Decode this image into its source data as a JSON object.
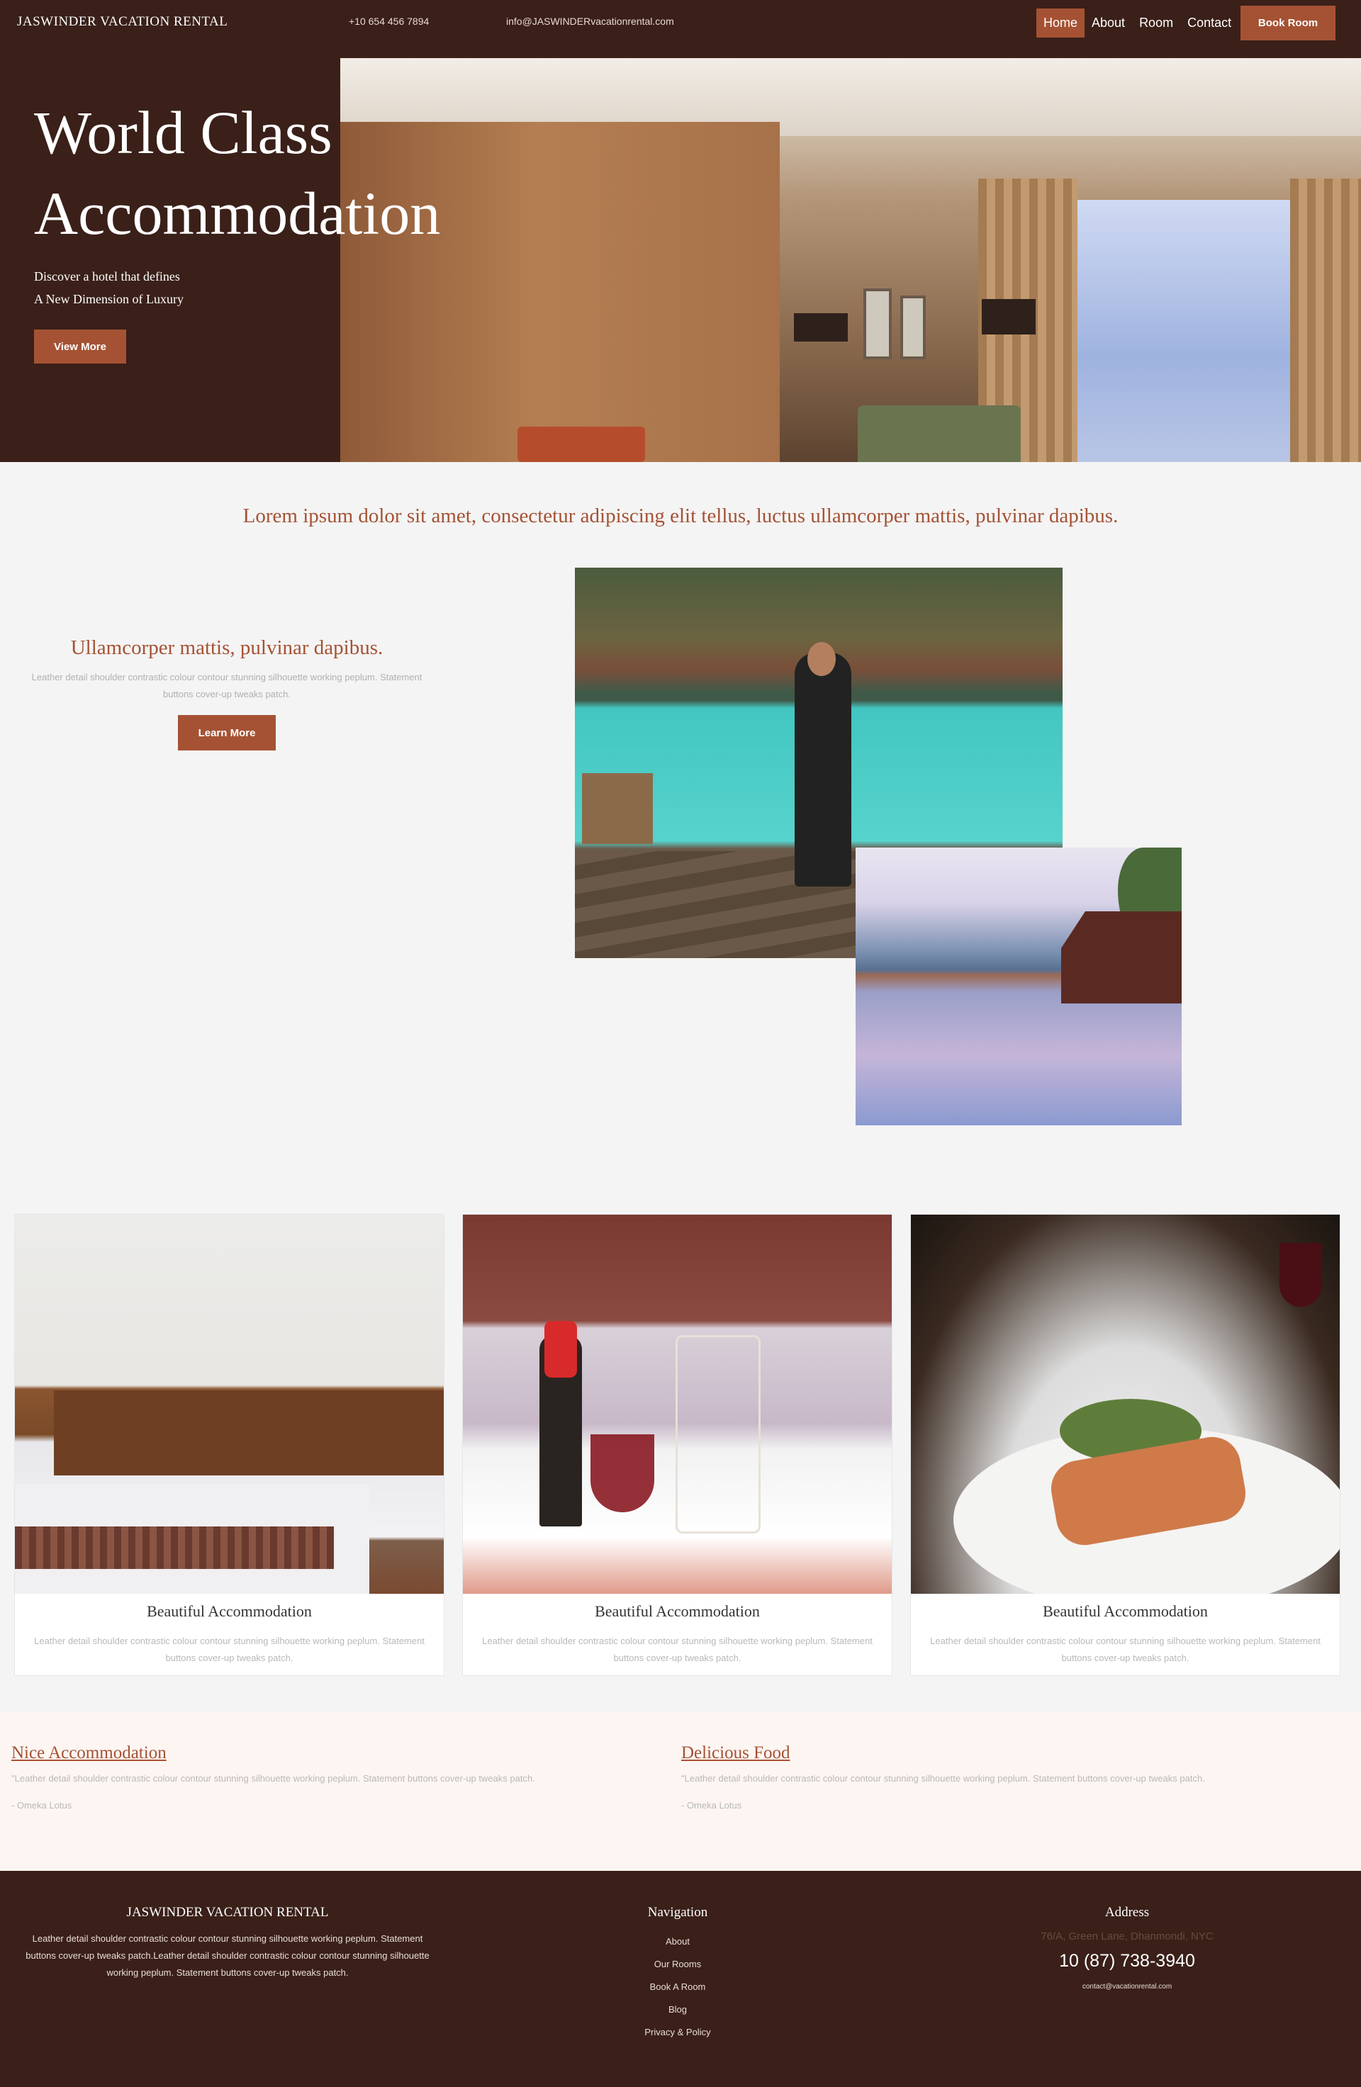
{
  "header": {
    "brand": "JASWINDER VACATION RENTAL",
    "phone": "+10 654 456 7894",
    "email": "info@JASWINDERvacationrental.com",
    "nav": [
      "Home",
      "About",
      "Room",
      "Contact"
    ],
    "book_label": "Book Room"
  },
  "hero": {
    "title_line1": "World Class",
    "title_line2": "Accommodation",
    "sub_line1": "Discover a hotel that defines",
    "sub_line2": "A New Dimension of Luxury",
    "button": "View More"
  },
  "intro": {
    "headline": "Lorem ipsum dolor sit amet, consectetur adipiscing elit tellus, luctus ullamcorper mattis, pulvinar dapibus."
  },
  "feature": {
    "title": "Ullamcorper mattis, pulvinar dapibus.",
    "desc": "Leather detail shoulder contrastic colour contour stunning silhouette working peplum. Statement buttons cover-up tweaks patch.",
    "button": "Learn More"
  },
  "cards": [
    {
      "title": "Beautiful Accommodation",
      "desc": "Leather detail shoulder contrastic colour contour stunning silhouette working peplum. Statement buttons cover-up tweaks patch."
    },
    {
      "title": "Beautiful Accommodation",
      "desc": "Leather detail shoulder contrastic colour contour stunning silhouette working peplum. Statement buttons cover-up tweaks patch."
    },
    {
      "title": "Beautiful Accommodation",
      "desc": "Leather detail shoulder contrastic colour contour stunning silhouette working peplum. Statement buttons cover-up tweaks patch."
    }
  ],
  "testimonials": [
    {
      "title": "Nice Accommodation",
      "quote": "\"Leather detail shoulder contrastic colour contour stunning silhouette working peplum. Statement buttons cover-up tweaks patch.",
      "author": "- Omeka Lotus"
    },
    {
      "title": "Delicious Food",
      "quote": "\"Leather detail shoulder contrastic colour contour stunning silhouette working peplum. Statement buttons cover-up tweaks patch.",
      "author": "- Omeka Lotus"
    }
  ],
  "footer": {
    "brand": "JASWINDER VACATION RENTAL",
    "about": "Leather detail shoulder contrastic colour contour stunning silhouette working peplum. Statement buttons cover-up tweaks patch.Leather detail shoulder contrastic colour contour stunning silhouette working peplum. Statement buttons cover-up tweaks patch.",
    "nav_title": "Navigation",
    "nav": [
      "About",
      "Our Rooms",
      "Book A Room",
      "Blog",
      "Privacy & Policy"
    ],
    "address_title": "Address",
    "address": "76/A, Green Lane, Dhanmondi, NYC",
    "phone": "10 (87) 738-3940",
    "email": "contact@vacationrental.com"
  },
  "colors": {
    "brown": "#3a2019",
    "accent": "#a55234",
    "blush": "#fdf5f2"
  }
}
